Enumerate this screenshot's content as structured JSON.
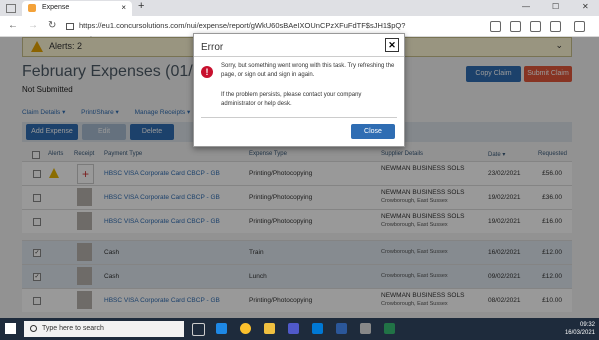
{
  "browser": {
    "tab_title": "Expense",
    "tab_close": "×",
    "new_tab": "+",
    "url": "https://eu1.concursolutions.com/nui/expense/report/gWkU60sBAeIXOUnCPzXFuFdTF$sJH1$pQ?reportId=75663BC942...",
    "window_controls": [
      "—",
      "☐",
      "✕"
    ],
    "nav": [
      "←",
      "→",
      "↻"
    ]
  },
  "alerts": {
    "label": "Alerts: 2",
    "chevron": "⌄"
  },
  "report": {
    "title": "February Expenses (01/02/",
    "status": "Not Submitted",
    "copy_label": "Copy Claim",
    "submit_label": "Submit Claim",
    "submit_color": "#e2573b",
    "accent": "#2f6db3"
  },
  "menus": [
    "Claim Details ▾",
    "Print/Share ▾",
    "Manage Receipts ▾"
  ],
  "toolbar": {
    "add_label": "Add Expense",
    "edit_label": "Edit",
    "delete_label": "Delete"
  },
  "table": {
    "headers": [
      "Alerts",
      "Receipt",
      "Payment Type",
      "Expense Type",
      "Supplier Details",
      "Date ▾",
      "Requested"
    ],
    "rows": [
      {
        "checked": false,
        "alert": true,
        "receipt": "add",
        "payment": "HBSC VISA Corporate Card CBCP - GB",
        "type": "Printing/Photocopying",
        "supplier": "NEWMAN BUSINESS SOLS",
        "location": "",
        "date": "23/02/2021",
        "amount": "£56.00"
      },
      {
        "checked": false,
        "alert": false,
        "receipt": "img",
        "payment": "HBSC VISA Corporate Card CBCP - GB",
        "type": "Printing/Photocopying",
        "supplier": "NEWMAN BUSINESS SOLS",
        "location": "Crowborough, East Sussex",
        "date": "19/02/2021",
        "amount": "£36.00"
      },
      {
        "checked": false,
        "alert": false,
        "receipt": "img",
        "payment": "HBSC VISA Corporate Card CBCP - GB",
        "type": "Printing/Photocopying",
        "supplier": "NEWMAN BUSINESS SOLS",
        "location": "Crowborough, East Sussex",
        "date": "19/02/2021",
        "amount": "£16.00"
      },
      {
        "checked": true,
        "alert": false,
        "receipt": "img",
        "payment": "Cash",
        "type": "Train",
        "supplier": "",
        "location": "Crowborough, East Sussex",
        "date": "16/02/2021",
        "amount": "£12.00"
      },
      {
        "checked": true,
        "alert": false,
        "receipt": "img",
        "payment": "Cash",
        "type": "Lunch",
        "supplier": "",
        "location": "Crowborough, East Sussex",
        "date": "09/02/2021",
        "amount": "£12.00"
      },
      {
        "checked": false,
        "alert": false,
        "receipt": "img",
        "payment": "HBSC VISA Corporate Card CBCP - GB",
        "type": "Printing/Photocopying",
        "supplier": "NEWMAN BUSINESS SOLS",
        "location": "Crowborough, East Sussex",
        "date": "08/02/2021",
        "amount": "£10.00"
      }
    ]
  },
  "modal": {
    "title": "Error",
    "close_x": "✕",
    "icon": "!",
    "message": "Sorry, but something went wrong with this task. Try refreshing the page, or sign out and sign in again.",
    "message2": "If the problem persists, please contact your company administrator or help desk.",
    "close_label": "Close"
  },
  "taskbar": {
    "search_placeholder": "Type here to search",
    "time": "09:32",
    "date": "16/03/2021",
    "apps": [
      "task-view-icon",
      "edge-icon",
      "chrome-icon",
      "file-explorer-icon",
      "teams-icon",
      "outlook-icon",
      "word-icon",
      "unknown-icon",
      "excel-icon"
    ]
  }
}
